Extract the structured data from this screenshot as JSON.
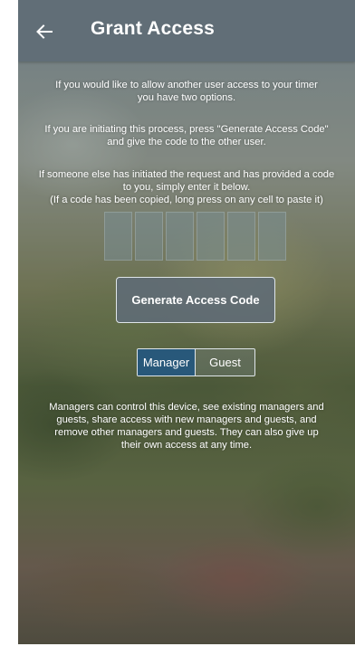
{
  "header": {
    "title": "Grant Access",
    "back_icon": "arrow-left-icon"
  },
  "instructions": {
    "intro": [
      "If you would like to allow another user access to your timer",
      "you have two options."
    ],
    "initiating": [
      "If you are initiating this process, press \"Generate Access Code\"",
      "and give the code to the other user."
    ],
    "receiving": [
      "If someone else has initiated the request and has provided a code",
      "to you, simply enter it below.",
      "(If a code has been copied, long press on any cell to paste it)"
    ]
  },
  "code_entry": {
    "cells": [
      "",
      "",
      "",
      "",
      "",
      ""
    ]
  },
  "actions": {
    "generate_label": "Generate Access Code"
  },
  "role_selector": {
    "options": [
      "Manager",
      "Guest"
    ],
    "selected": "Manager"
  },
  "role_description": [
    "Managers can control this device, see existing managers and",
    "guests, share access with new managers and guests, and",
    "remove other managers and guests. They can also give up",
    "their own access at any time."
  ],
  "colors": {
    "appbar": "#5f6c76",
    "selected_segment": "#28587a",
    "text": "#ffffff"
  }
}
